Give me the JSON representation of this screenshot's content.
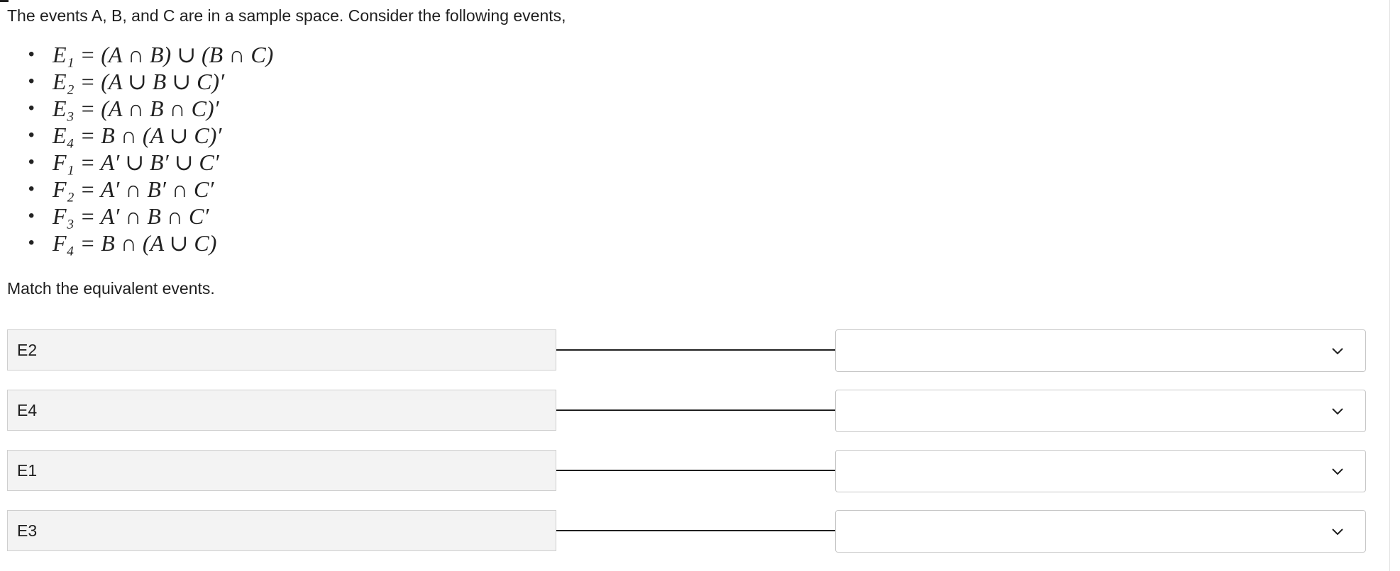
{
  "question": {
    "intro": "The events A, B, and C are in a sample space. Consider the following events,",
    "events": [
      {
        "label": "E₁ = (A ∩ B) ∪ (B ∩ C)"
      },
      {
        "label": "E₂ = (A ∪ B ∪ C)′"
      },
      {
        "label": "E₃ =  (A ∩ B ∩ C)′"
      },
      {
        "label": "E₄ = B ∩ (A ∪ C)′"
      },
      {
        "label": "F₁ = A′ ∪ B′ ∪ C′"
      },
      {
        "label": "F₂ = A′ ∩ B′ ∩ C′"
      },
      {
        "label": "F₃ = A′ ∩ B ∩ C′"
      },
      {
        "label": "F₄ = B ∩ (A ∪ C)"
      }
    ],
    "instruction": "Match the equivalent events."
  },
  "matching": {
    "rows": [
      {
        "prompt": "E2",
        "selected": ""
      },
      {
        "prompt": "E4",
        "selected": ""
      },
      {
        "prompt": "E1",
        "selected": ""
      },
      {
        "prompt": "E3",
        "selected": ""
      }
    ],
    "dropdown_icon": "chevron-down-icon"
  },
  "colors": {
    "prompt_background": "#f3f3f3",
    "border": "#cfcfcf",
    "text": "#1f1f1f"
  }
}
